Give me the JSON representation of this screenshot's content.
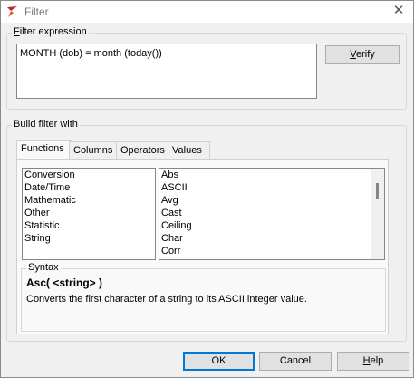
{
  "window": {
    "title": "Filter"
  },
  "filter_expression": {
    "legend": "Filter expression",
    "legend_hotkey": "F",
    "legend_rest": "ilter expression",
    "value": "MONTH (dob) = month (today())"
  },
  "buttons": {
    "verify": {
      "hotkey": "V",
      "rest": "erify"
    },
    "ok": "OK",
    "cancel": "Cancel",
    "help": {
      "hotkey": "H",
      "rest": "elp"
    }
  },
  "build": {
    "legend": "Build filter with",
    "tabs": [
      "Functions",
      "Columns",
      "Operators",
      "Values"
    ],
    "active_tab": "Functions",
    "categories": [
      "Conversion",
      "Date/Time",
      "Mathematic",
      "Other",
      "Statistic",
      "String"
    ],
    "functions": [
      "Abs",
      "ASCII",
      "Avg",
      "Cast",
      "Ceiling",
      "Char",
      "Corr"
    ],
    "syntax": {
      "legend": "Syntax",
      "signature": "Asc( <string> )",
      "description": "Converts the first character of a string to its ASCII integer value."
    }
  },
  "colors": {
    "accent": "#0078d7",
    "background": "#f0f0f0"
  }
}
